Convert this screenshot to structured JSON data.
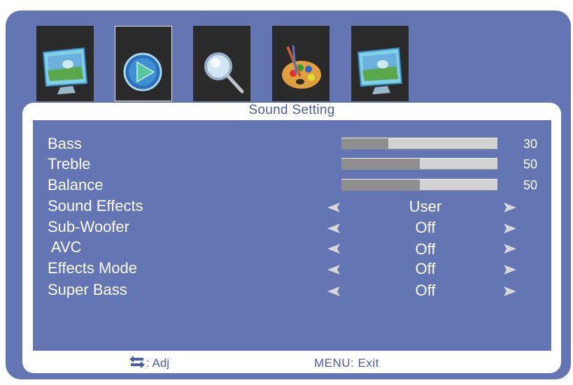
{
  "menu": {
    "tabs": [
      {
        "icon": "picture-monitor-icon",
        "selected": false
      },
      {
        "icon": "sound-play-icon",
        "selected": true
      },
      {
        "icon": "magnifier-icon",
        "selected": false
      },
      {
        "icon": "palette-icon",
        "selected": false
      },
      {
        "icon": "setup-monitor-icon",
        "selected": false
      }
    ]
  },
  "title": "Sound Setting",
  "settings": {
    "bass": {
      "label": "Bass",
      "value": "30",
      "level": 30
    },
    "treble": {
      "label": "Treble",
      "value": "50",
      "level": 50
    },
    "balance": {
      "label": "Balance",
      "value": "50",
      "level": 50
    },
    "sound_effects": {
      "label": "Sound Effects",
      "value": "User"
    },
    "sub_woofer": {
      "label": "Sub-Woofer",
      "value": "Off"
    },
    "avc": {
      "label": " AVC",
      "value": "Off"
    },
    "effects_mode": {
      "label": "Effects Mode",
      "value": "Off"
    },
    "super_bass": {
      "label": "Super Bass",
      "value": "Off"
    }
  },
  "footer": {
    "adjust_icon": "swap-arrows-icon",
    "adjust_label": ": Adj",
    "exit_label": "MENU: Exit"
  },
  "colors": {
    "background": "#6475b4",
    "frame": "#ffffff",
    "text": "#ffffff",
    "title_text": "#4d5ea3"
  }
}
